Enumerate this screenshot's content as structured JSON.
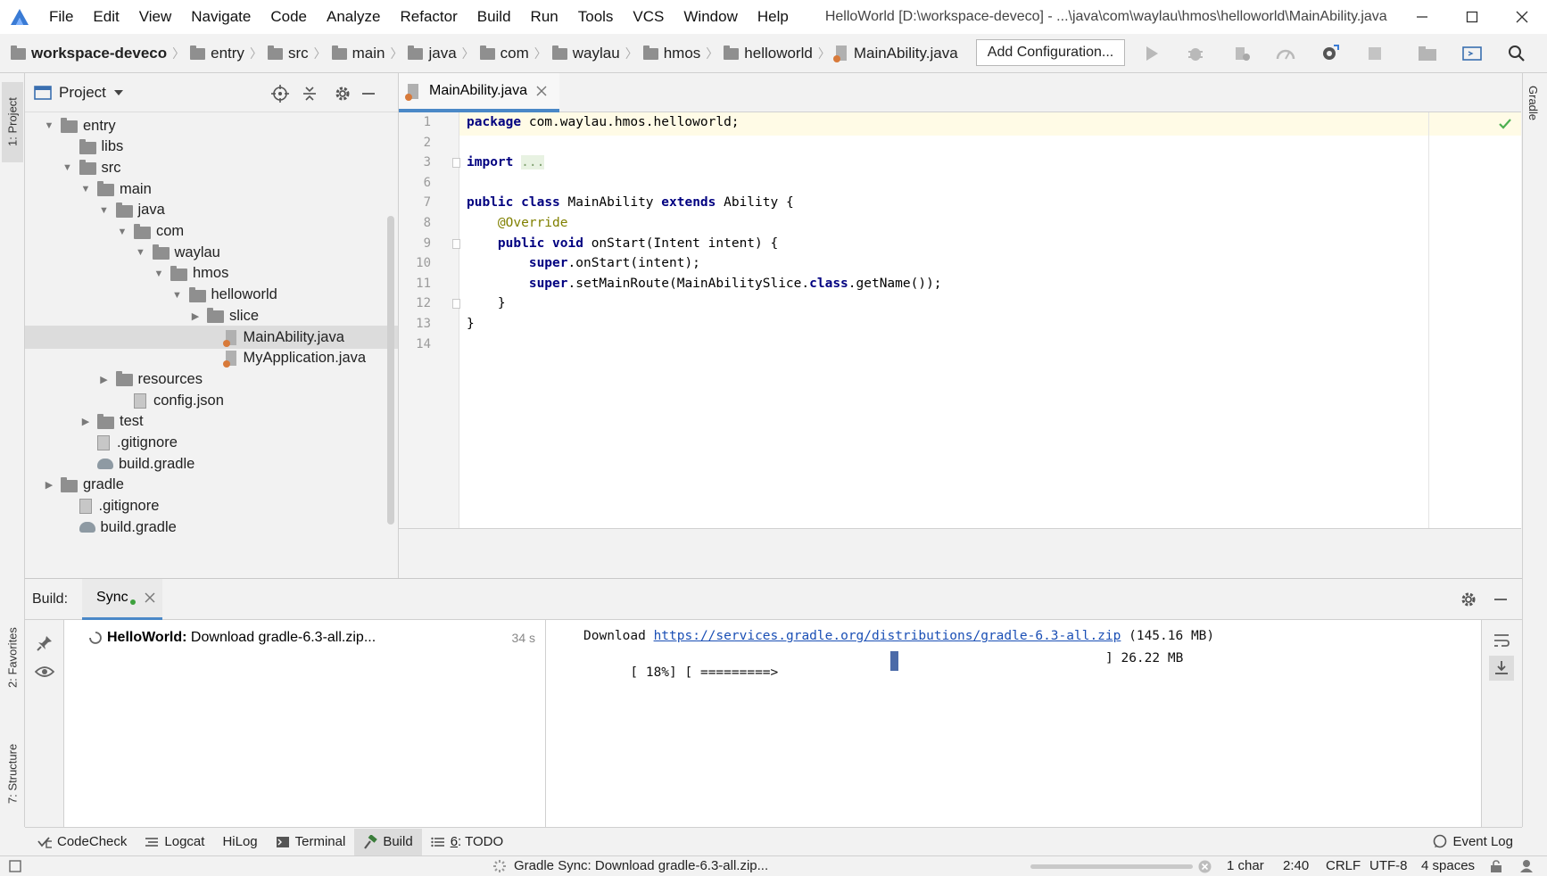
{
  "window": {
    "title": "HelloWorld [D:\\workspace-deveco] - ...\\java\\com\\waylau\\hmos\\helloworld\\MainAbility.java"
  },
  "menu": [
    "File",
    "Edit",
    "View",
    "Navigate",
    "Code",
    "Analyze",
    "Refactor",
    "Build",
    "Run",
    "Tools",
    "VCS",
    "Window",
    "Help"
  ],
  "breadcrumb": [
    "workspace-deveco",
    "entry",
    "src",
    "main",
    "java",
    "com",
    "waylau",
    "hmos",
    "helloworld",
    "MainAbility.java"
  ],
  "toolbar": {
    "add_config_label": "Add Configuration..."
  },
  "left_strip": {
    "project_tab": "1: Project",
    "favorites_tab": "2: Favorites",
    "structure_tab": "7: Structure"
  },
  "right_strip": {
    "gradle_tab": "Gradle"
  },
  "project_panel": {
    "title": "Project",
    "tree": [
      {
        "label": "entry",
        "type": "folder",
        "expanded": true,
        "depth": 1
      },
      {
        "label": "libs",
        "type": "folder",
        "expanded": null,
        "depth": 2
      },
      {
        "label": "src",
        "type": "folder",
        "expanded": true,
        "depth": 2
      },
      {
        "label": "main",
        "type": "folder",
        "expanded": true,
        "depth": 3
      },
      {
        "label": "java",
        "type": "folder",
        "expanded": true,
        "depth": 4
      },
      {
        "label": "com",
        "type": "folder",
        "expanded": true,
        "depth": 5
      },
      {
        "label": "waylau",
        "type": "folder",
        "expanded": true,
        "depth": 6
      },
      {
        "label": "hmos",
        "type": "folder",
        "expanded": true,
        "depth": 7
      },
      {
        "label": "helloworld",
        "type": "folder",
        "expanded": true,
        "depth": 8
      },
      {
        "label": "slice",
        "type": "folder",
        "expanded": false,
        "depth": 9
      },
      {
        "label": "MainAbility.java",
        "type": "java",
        "expanded": null,
        "depth": 10,
        "selected": true
      },
      {
        "label": "MyApplication.java",
        "type": "java",
        "expanded": null,
        "depth": 10
      },
      {
        "label": "resources",
        "type": "folder",
        "expanded": false,
        "depth": 4
      },
      {
        "label": "config.json",
        "type": "file",
        "expanded": null,
        "depth": 5
      },
      {
        "label": "test",
        "type": "folder",
        "expanded": false,
        "depth": 3
      },
      {
        "label": ".gitignore",
        "type": "file",
        "expanded": null,
        "depth": 3
      },
      {
        "label": "build.gradle",
        "type": "gradle",
        "expanded": null,
        "depth": 3
      },
      {
        "label": "gradle",
        "type": "folder",
        "expanded": false,
        "depth": 1
      },
      {
        "label": ".gitignore",
        "type": "file",
        "expanded": null,
        "depth": 2
      },
      {
        "label": "build.gradle",
        "type": "gradle",
        "expanded": null,
        "depth": 2
      }
    ]
  },
  "editor": {
    "tab_label": "MainAbility.java",
    "line_numbers": [
      "1",
      "2",
      "3",
      "6",
      "7",
      "8",
      "9",
      "10",
      "11",
      "12",
      "13",
      "14"
    ],
    "lines": [
      [
        {
          "t": "package",
          "c": "kw"
        },
        {
          "t": " com.waylau.hmos.helloworld;",
          "c": ""
        }
      ],
      [],
      [
        {
          "t": "import",
          "c": "kw"
        },
        {
          "t": " ",
          "c": ""
        },
        {
          "t": "...",
          "c": "fold"
        }
      ],
      [],
      [
        {
          "t": "public",
          "c": "kw"
        },
        {
          "t": " ",
          "c": ""
        },
        {
          "t": "class",
          "c": "kw"
        },
        {
          "t": " MainAbility ",
          "c": ""
        },
        {
          "t": "extends",
          "c": "kw"
        },
        {
          "t": " Ability {",
          "c": ""
        }
      ],
      [
        {
          "t": "    @Override",
          "c": "ann"
        }
      ],
      [
        {
          "t": "    ",
          "c": ""
        },
        {
          "t": "public",
          "c": "kw"
        },
        {
          "t": " ",
          "c": ""
        },
        {
          "t": "void",
          "c": "kw"
        },
        {
          "t": " onStart(Intent intent) {",
          "c": ""
        }
      ],
      [
        {
          "t": "        ",
          "c": ""
        },
        {
          "t": "super",
          "c": "kw"
        },
        {
          "t": ".onStart(intent);",
          "c": ""
        }
      ],
      [
        {
          "t": "        ",
          "c": ""
        },
        {
          "t": "super",
          "c": "kw"
        },
        {
          "t": ".setMainRoute(MainAbilitySlice.",
          "c": ""
        },
        {
          "t": "class",
          "c": "kw"
        },
        {
          "t": ".getName());",
          "c": ""
        }
      ],
      [
        {
          "t": "    }",
          "c": ""
        }
      ],
      [
        {
          "t": "}",
          "c": ""
        }
      ],
      []
    ]
  },
  "build_panel": {
    "label": "Build:",
    "sync_tab": "Sync",
    "task_name": "HelloWorld:",
    "task_desc": " Download gradle-6.3-all.zip...",
    "task_time": "34 s",
    "output_prefix": "Download ",
    "output_url": "https://services.gradle.org/distributions/gradle-6.3-all.zip",
    "output_size": " (145.16 MB)",
    "progress_start": "[ 18%] [ =========>",
    "progress_end": "] 26.22 MB",
    "progress_percent": 18
  },
  "bottom_tabs": {
    "codecheck": "CodeCheck",
    "logcat": "Logcat",
    "hilog": "HiLog",
    "terminal": "Terminal",
    "build": "Build",
    "todo_num": "6",
    "todo": ": TODO",
    "event_log": "Event Log"
  },
  "statusbar": {
    "message": "Gradle Sync: Download gradle-6.3-all.zip...",
    "selection": "1 char",
    "position": "2:40",
    "line_ending": "CRLF",
    "encoding": "UTF-8",
    "indent": "4 spaces"
  },
  "colors": {
    "keyword": "#000080",
    "annotation": "#808000",
    "accent": "#4a88c7",
    "link": "#1a4fb5"
  }
}
